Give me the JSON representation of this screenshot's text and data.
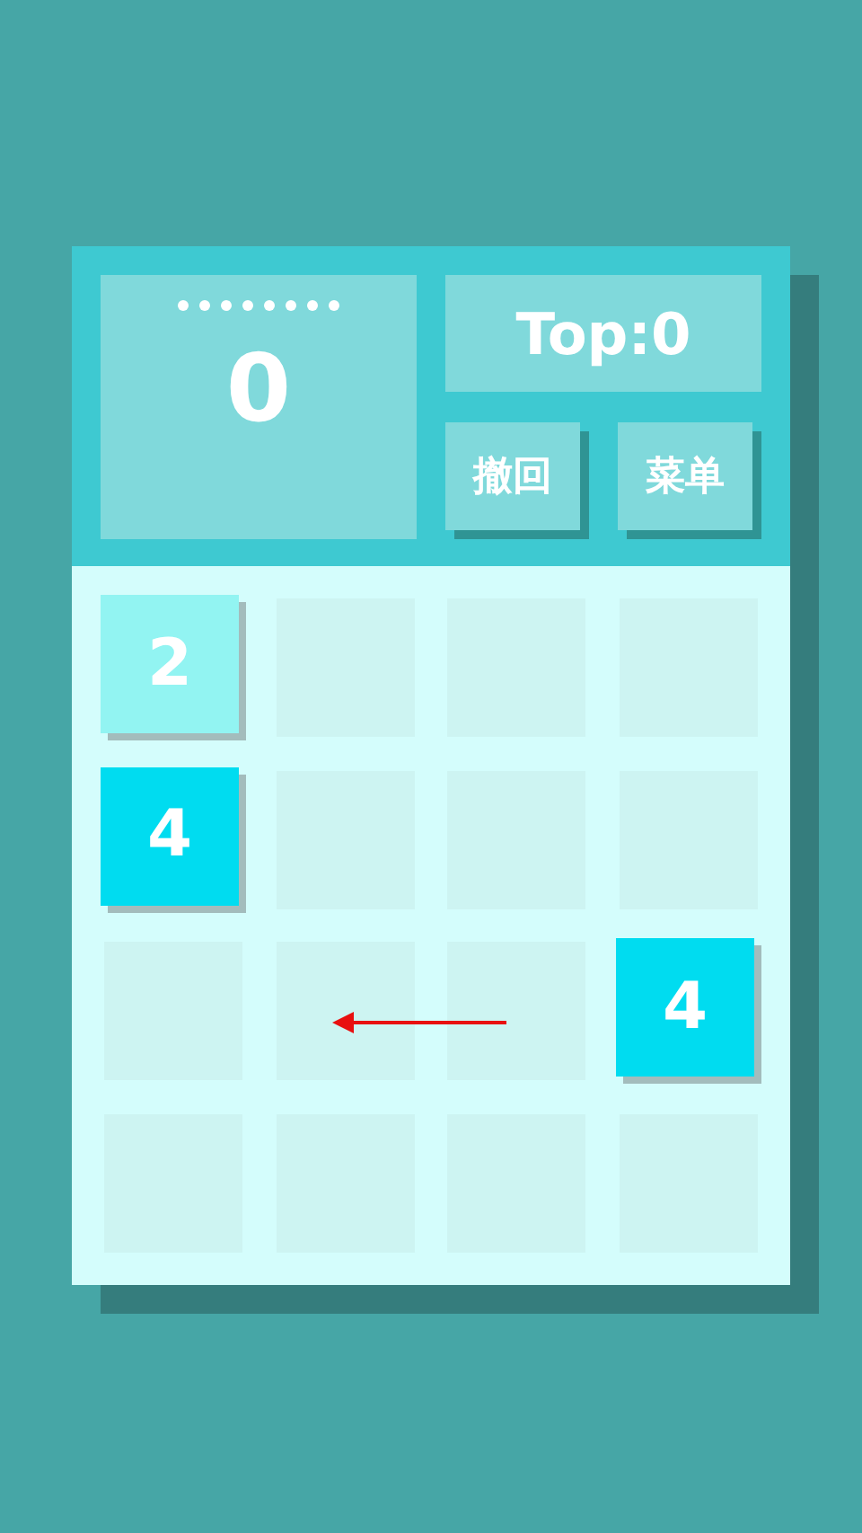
{
  "score": {
    "value": "0"
  },
  "best": "Top:0",
  "buttons": [
    "撤回",
    "菜单"
  ],
  "board": [
    [
      {
        "kind": "tile",
        "value": "2",
        "color": "#92f4f2"
      },
      {
        "kind": "empty"
      },
      {
        "kind": "empty"
      },
      {
        "kind": "empty"
      }
    ],
    [
      {
        "kind": "tile",
        "value": "4",
        "color": "#00dcf0"
      },
      {
        "kind": "empty"
      },
      {
        "kind": "empty"
      },
      {
        "kind": "empty"
      }
    ],
    [
      {
        "kind": "empty"
      },
      {
        "kind": "empty"
      },
      {
        "kind": "empty"
      },
      {
        "kind": "tile",
        "value": "4",
        "color": "#00dcf0"
      }
    ],
    [
      {
        "kind": "empty"
      },
      {
        "kind": "empty"
      },
      {
        "kind": "empty"
      },
      {
        "kind": "empty"
      }
    ]
  ]
}
